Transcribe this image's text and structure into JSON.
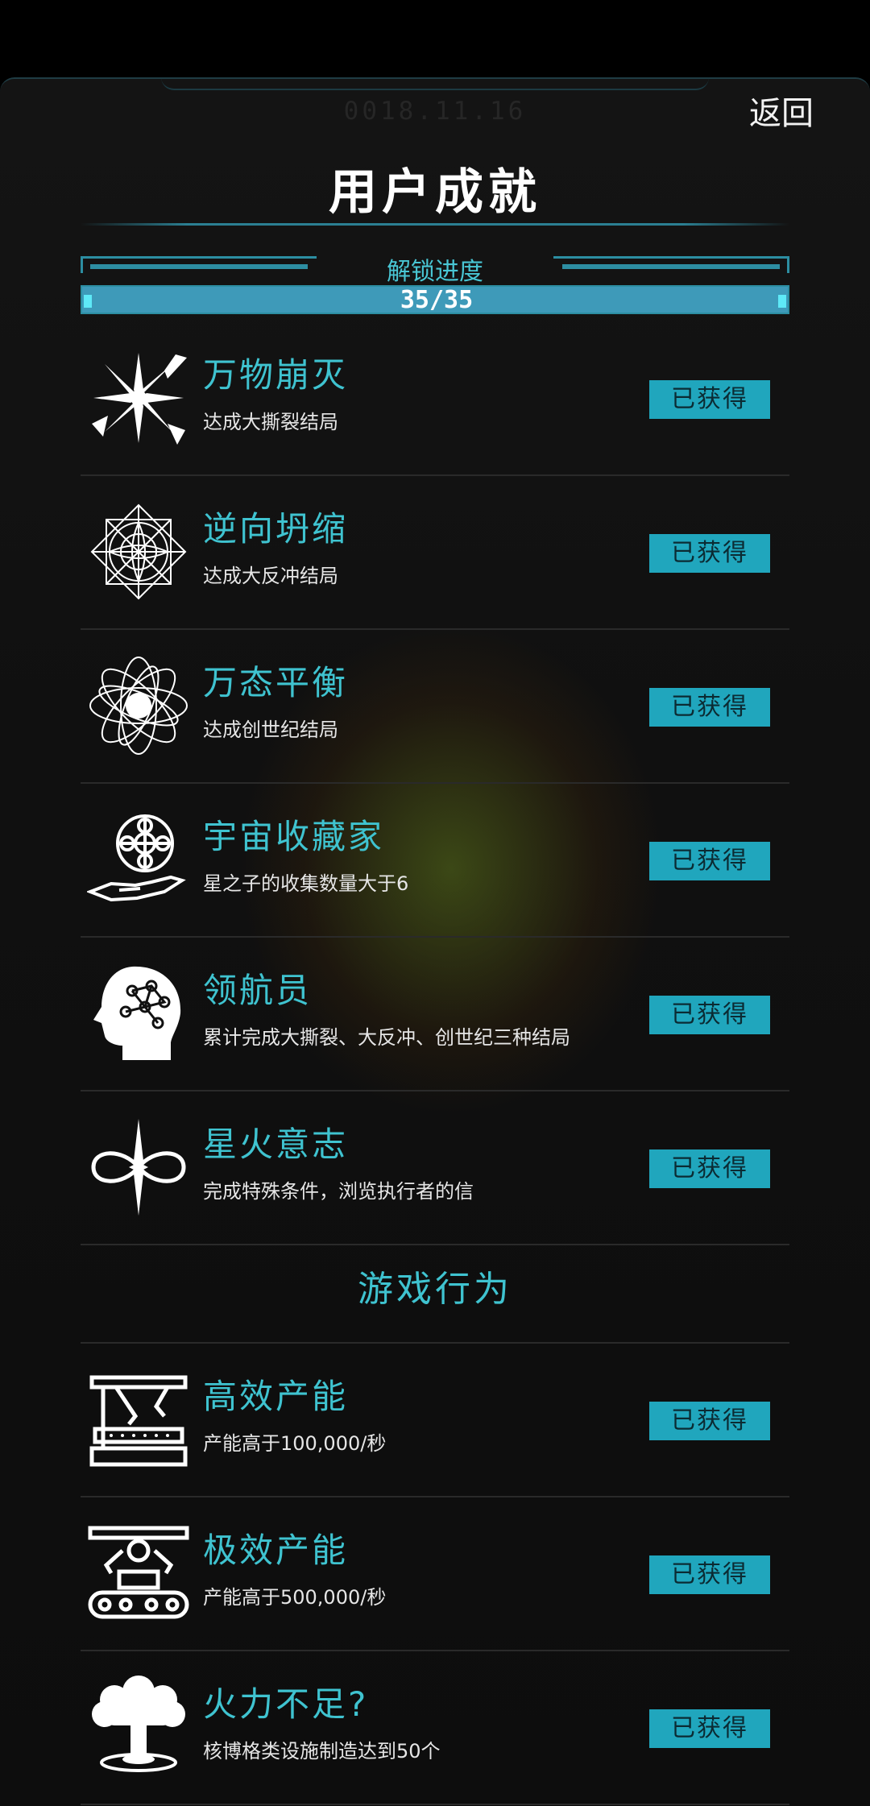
{
  "header": {
    "date": "0018.11.16",
    "back_label": "返回",
    "title": "用户成就"
  },
  "progress": {
    "label": "解锁进度",
    "text": "35/35",
    "unlocked": 35,
    "total": 35,
    "fraction": 1.0
  },
  "colors": {
    "accent": "#3fc3d0",
    "button_bg": "#20a6bd",
    "progress_fill": "#3e9ab9"
  },
  "achievements": [
    {
      "name": "万物崩灭",
      "desc": "达成大撕裂结局",
      "status": "已获得",
      "icon": "explosion-icon"
    },
    {
      "name": "逆向坍缩",
      "desc": "达成大反冲结局",
      "status": "已获得",
      "icon": "mandala-icon"
    },
    {
      "name": "万态平衡",
      "desc": "达成创世纪结局",
      "status": "已获得",
      "icon": "orbit-icon"
    },
    {
      "name": "宇宙收藏家",
      "desc": "星之子的收集数量大于6",
      "status": "已获得",
      "icon": "hand-globe-icon"
    },
    {
      "name": "领航员",
      "desc": "累计完成大撕裂、大反冲、创世纪三种结局",
      "status": "已获得",
      "icon": "brain-head-icon"
    },
    {
      "name": "星火意志",
      "desc": "完成特殊条件，浏览执行者的信",
      "status": "已获得",
      "icon": "infinity-star-icon"
    }
  ],
  "section2": {
    "title": "游戏行为",
    "items": [
      {
        "name": "高效产能",
        "desc": "产能高于100,000/秒",
        "status": "已获得",
        "icon": "factory-arm-icon"
      },
      {
        "name": "极效产能",
        "desc": "产能高于500,000/秒",
        "status": "已获得",
        "icon": "conveyor-robot-icon"
      },
      {
        "name": "火力不足?",
        "desc": "核博格类设施制造达到50个",
        "status": "已获得",
        "icon": "mushroom-cloud-icon"
      }
    ]
  }
}
